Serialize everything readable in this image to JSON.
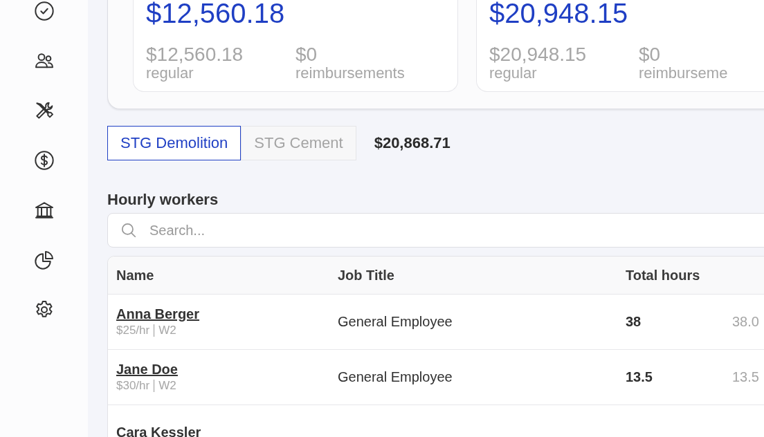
{
  "sidebar": {
    "items": [
      {
        "kind": "tasks"
      },
      {
        "kind": "team"
      },
      {
        "kind": "jobs"
      },
      {
        "kind": "payroll"
      },
      {
        "kind": "banking"
      },
      {
        "kind": "reports"
      },
      {
        "kind": "settings"
      }
    ]
  },
  "summary_cards": [
    {
      "total": "$12,560.18",
      "breakdown": [
        {
          "amount": "$12,560.18",
          "label": "regular"
        },
        {
          "amount": "$0",
          "label": "reimbursements"
        }
      ]
    },
    {
      "total": "$20,948.15",
      "breakdown": [
        {
          "amount": "$20,948.15",
          "label": "regular"
        },
        {
          "amount": "$0",
          "label": "reimburseme"
        }
      ]
    }
  ],
  "company_tabs": [
    {
      "label": "STG Demolition",
      "selected": true
    },
    {
      "label": "STG Cement",
      "selected": false
    }
  ],
  "company_total": "$20,868.71",
  "section_title": "Hourly workers",
  "search": {
    "placeholder": "Search..."
  },
  "table": {
    "columns": [
      "Name",
      "Job Title",
      "Total hours"
    ],
    "rows": [
      {
        "name": "Anna Berger",
        "rate": "$25/hr",
        "type": "W2",
        "job_title": "General Employee",
        "total_hours": "38",
        "column_4": "38.0"
      },
      {
        "name": "Jane Doe",
        "rate": "$30/hr",
        "type": "W2",
        "job_title": "General Employee",
        "total_hours": "13.5",
        "column_4": "13.5"
      },
      {
        "name": "Cara Kessler"
      }
    ]
  }
}
